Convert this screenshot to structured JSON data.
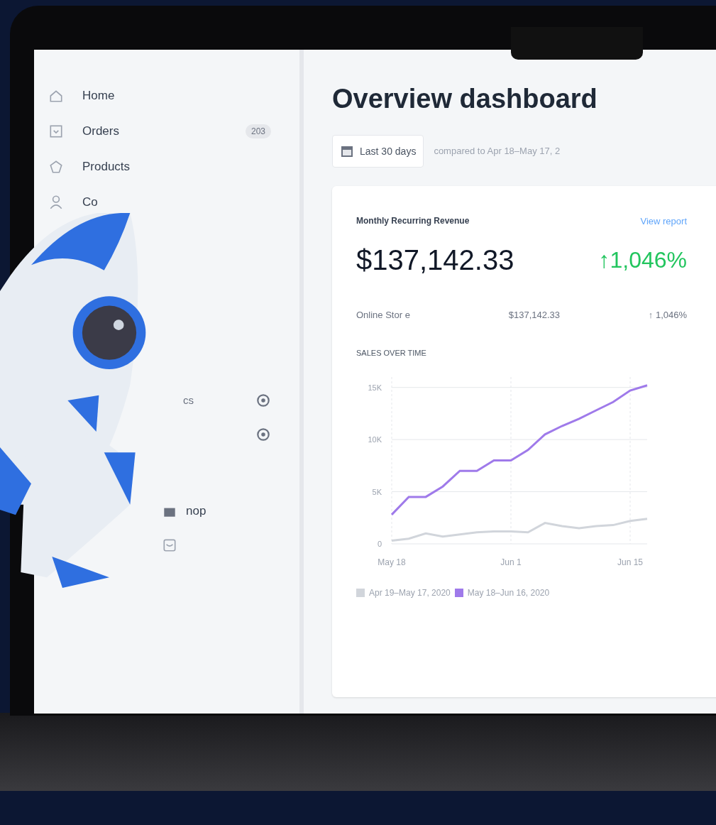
{
  "sidebar": {
    "items": [
      {
        "kind": "home",
        "label": "Home"
      },
      {
        "kind": "orders",
        "label": "Orders",
        "badge": "203"
      },
      {
        "kind": "products",
        "label": "Products"
      },
      {
        "kind": "person",
        "label": "Co"
      }
    ],
    "lower_items": [
      {
        "kind": "circle",
        "label": "cs"
      },
      {
        "kind": "circle"
      }
    ],
    "bottom_items": [
      {
        "kind": "store",
        "label": "nop"
      },
      {
        "kind": "tray"
      }
    ]
  },
  "main": {
    "title": "Overview dashboard",
    "date_button": "Last 30 days",
    "comparison": "compared to Apr 18–May 17, 2",
    "card": {
      "title": "Monthly Recurring Revenue",
      "link": "View report",
      "total": "$137,142.33",
      "change": "↑1,046%",
      "rows": [
        {
          "label": "Online Stor e",
          "value": "$137,142.33",
          "change": "↑ 1,046%"
        }
      ],
      "chart_title": "SALES OVER TIME",
      "chart_data": {
        "type": "line",
        "categories": [
          "May 18",
          null,
          null,
          null,
          null,
          null,
          null,
          "Jun 1",
          null,
          null,
          null,
          null,
          null,
          null,
          "Jun 15",
          null
        ],
        "yticks": [
          {
            "value": 0,
            "label": "0"
          },
          {
            "value": 5000,
            "label": "5K"
          },
          {
            "value": 10000,
            "label": "10K"
          },
          {
            "value": 15000,
            "label": "15K"
          }
        ],
        "ylim": [
          0,
          16000
        ],
        "grid": true,
        "series": [
          {
            "name": "Apr 19–May 17, 2020",
            "color": "#d1d5db",
            "values": [
              300,
              500,
              1000,
              700,
              900,
              1100,
              1200,
              1200,
              1100,
              2000,
              1700,
              1500,
              1700,
              1800,
              2200,
              2400
            ]
          },
          {
            "name": "May 18–Jun 16, 2020",
            "color": "#9f7aea",
            "values": [
              2800,
              4500,
              4500,
              5500,
              7000,
              7000,
              8000,
              8000,
              9000,
              10500,
              11300,
              12000,
              12800,
              13600,
              14700,
              15200
            ]
          }
        ]
      }
    }
  }
}
